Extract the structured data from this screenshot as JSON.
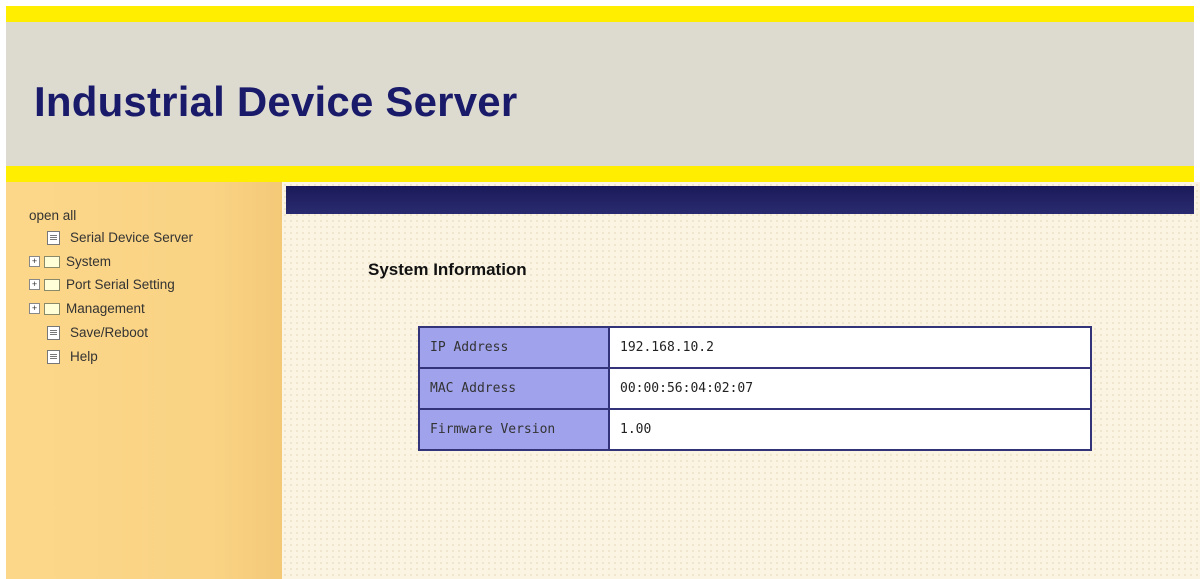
{
  "header": {
    "title": "Industrial Device Server"
  },
  "sidebar": {
    "open_all": "open all",
    "items": [
      {
        "label": "Serial Device Server",
        "icon": "page-icon"
      },
      {
        "label": "System",
        "icon": "folder-icon",
        "expander": "+"
      },
      {
        "label": "Port Serial Setting",
        "icon": "folder-icon",
        "expander": "+"
      },
      {
        "label": "Management",
        "icon": "folder-icon",
        "expander": "+"
      },
      {
        "label": "Save/Reboot",
        "icon": "page-icon"
      },
      {
        "label": "Help",
        "icon": "page-icon"
      }
    ]
  },
  "main": {
    "section_title": "System Information",
    "rows": [
      {
        "label": "IP Address",
        "value": "192.168.10.2"
      },
      {
        "label": "MAC Address",
        "value": "00:00:56:04:02:07"
      },
      {
        "label": "Firmware Version",
        "value": "1.00"
      }
    ]
  },
  "colors": {
    "accent_yellow": "#ffee00",
    "title_navy": "#1a1a6a",
    "sidebar_bg": "#fad384",
    "table_label_bg": "#a0a2ec",
    "table_border": "#33337a"
  }
}
